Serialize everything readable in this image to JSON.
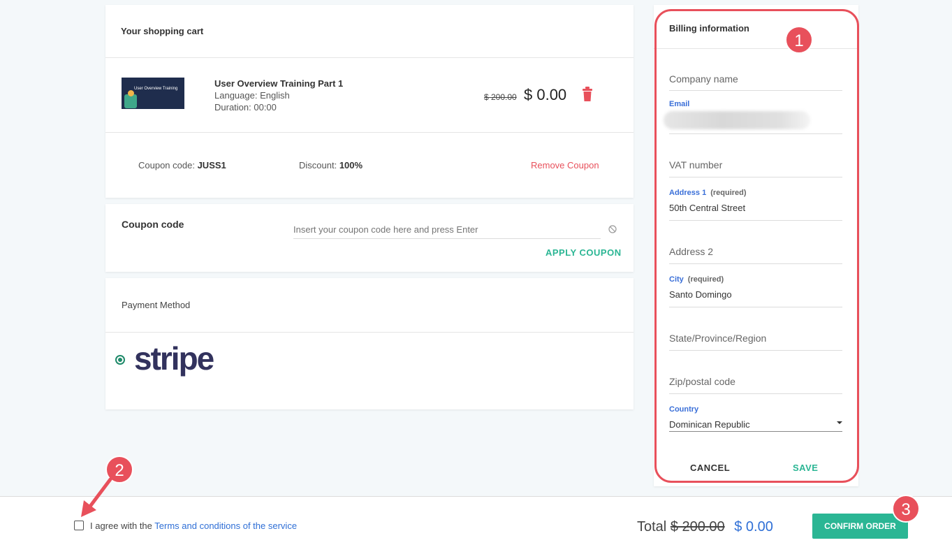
{
  "cart": {
    "title": "Your shopping cart",
    "item": {
      "name": "User Overview Training Part 1",
      "language": "Language: English",
      "duration": "Duration: 00:00",
      "old_price": "$ 200.00",
      "price": "$ 0.00",
      "thumb_text": "User Overview Training"
    },
    "coupon_label": "Coupon code:",
    "coupon_value": "JUSS1",
    "discount_label": "Discount:",
    "discount_value": "100%",
    "remove_coupon": "Remove Coupon"
  },
  "coupon": {
    "title": "Coupon code",
    "placeholder": "Insert your coupon code here and press Enter",
    "apply": "APPLY COUPON"
  },
  "payment": {
    "title": "Payment Method",
    "method": "stripe"
  },
  "billing": {
    "title": "Billing information",
    "company": "Company name",
    "email_label": "Email",
    "vat": "VAT number",
    "address1_label": "Address 1",
    "address1_req": "(required)",
    "address1_value": "50th Central Street",
    "address2": "Address 2",
    "city_label": "City",
    "city_req": "(required)",
    "city_value": "Santo Domingo",
    "state": "State/Province/Region",
    "zip": "Zip/postal code",
    "country_label": "Country",
    "country_value": "Dominican Republic",
    "cancel": "CANCEL",
    "save": "SAVE"
  },
  "footer": {
    "agree_text": "I agree with the",
    "terms_link": "Terms and conditions of the service",
    "total_label": "Total",
    "total_old": "$ 200.00",
    "total_new": "$ 0.00",
    "confirm": "CONFIRM ORDER"
  },
  "annotations": {
    "badge1": "1",
    "badge2": "2",
    "badge3": "3"
  },
  "colors": {
    "accent_green": "#2bb694",
    "danger": "#e8505b",
    "link_blue": "#2f6fd6",
    "stripe_navy": "#32325d"
  }
}
